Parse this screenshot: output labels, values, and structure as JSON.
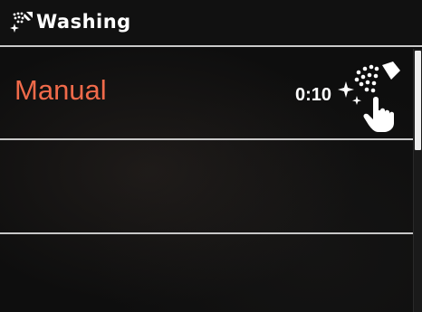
{
  "header": {
    "title": "Washing",
    "icon": "washing-spray-icon"
  },
  "programs": [
    {
      "name": "Manual",
      "time": "0:10",
      "icon": "manual-spray-touch-icon",
      "selected": true
    },
    {
      "name": "",
      "time": ""
    },
    {
      "name": "",
      "time": ""
    }
  ],
  "colors": {
    "accent": "#f06a4a",
    "text": "#ffffff",
    "background": "#0e0e0e",
    "divider": "#c8c8c8"
  }
}
